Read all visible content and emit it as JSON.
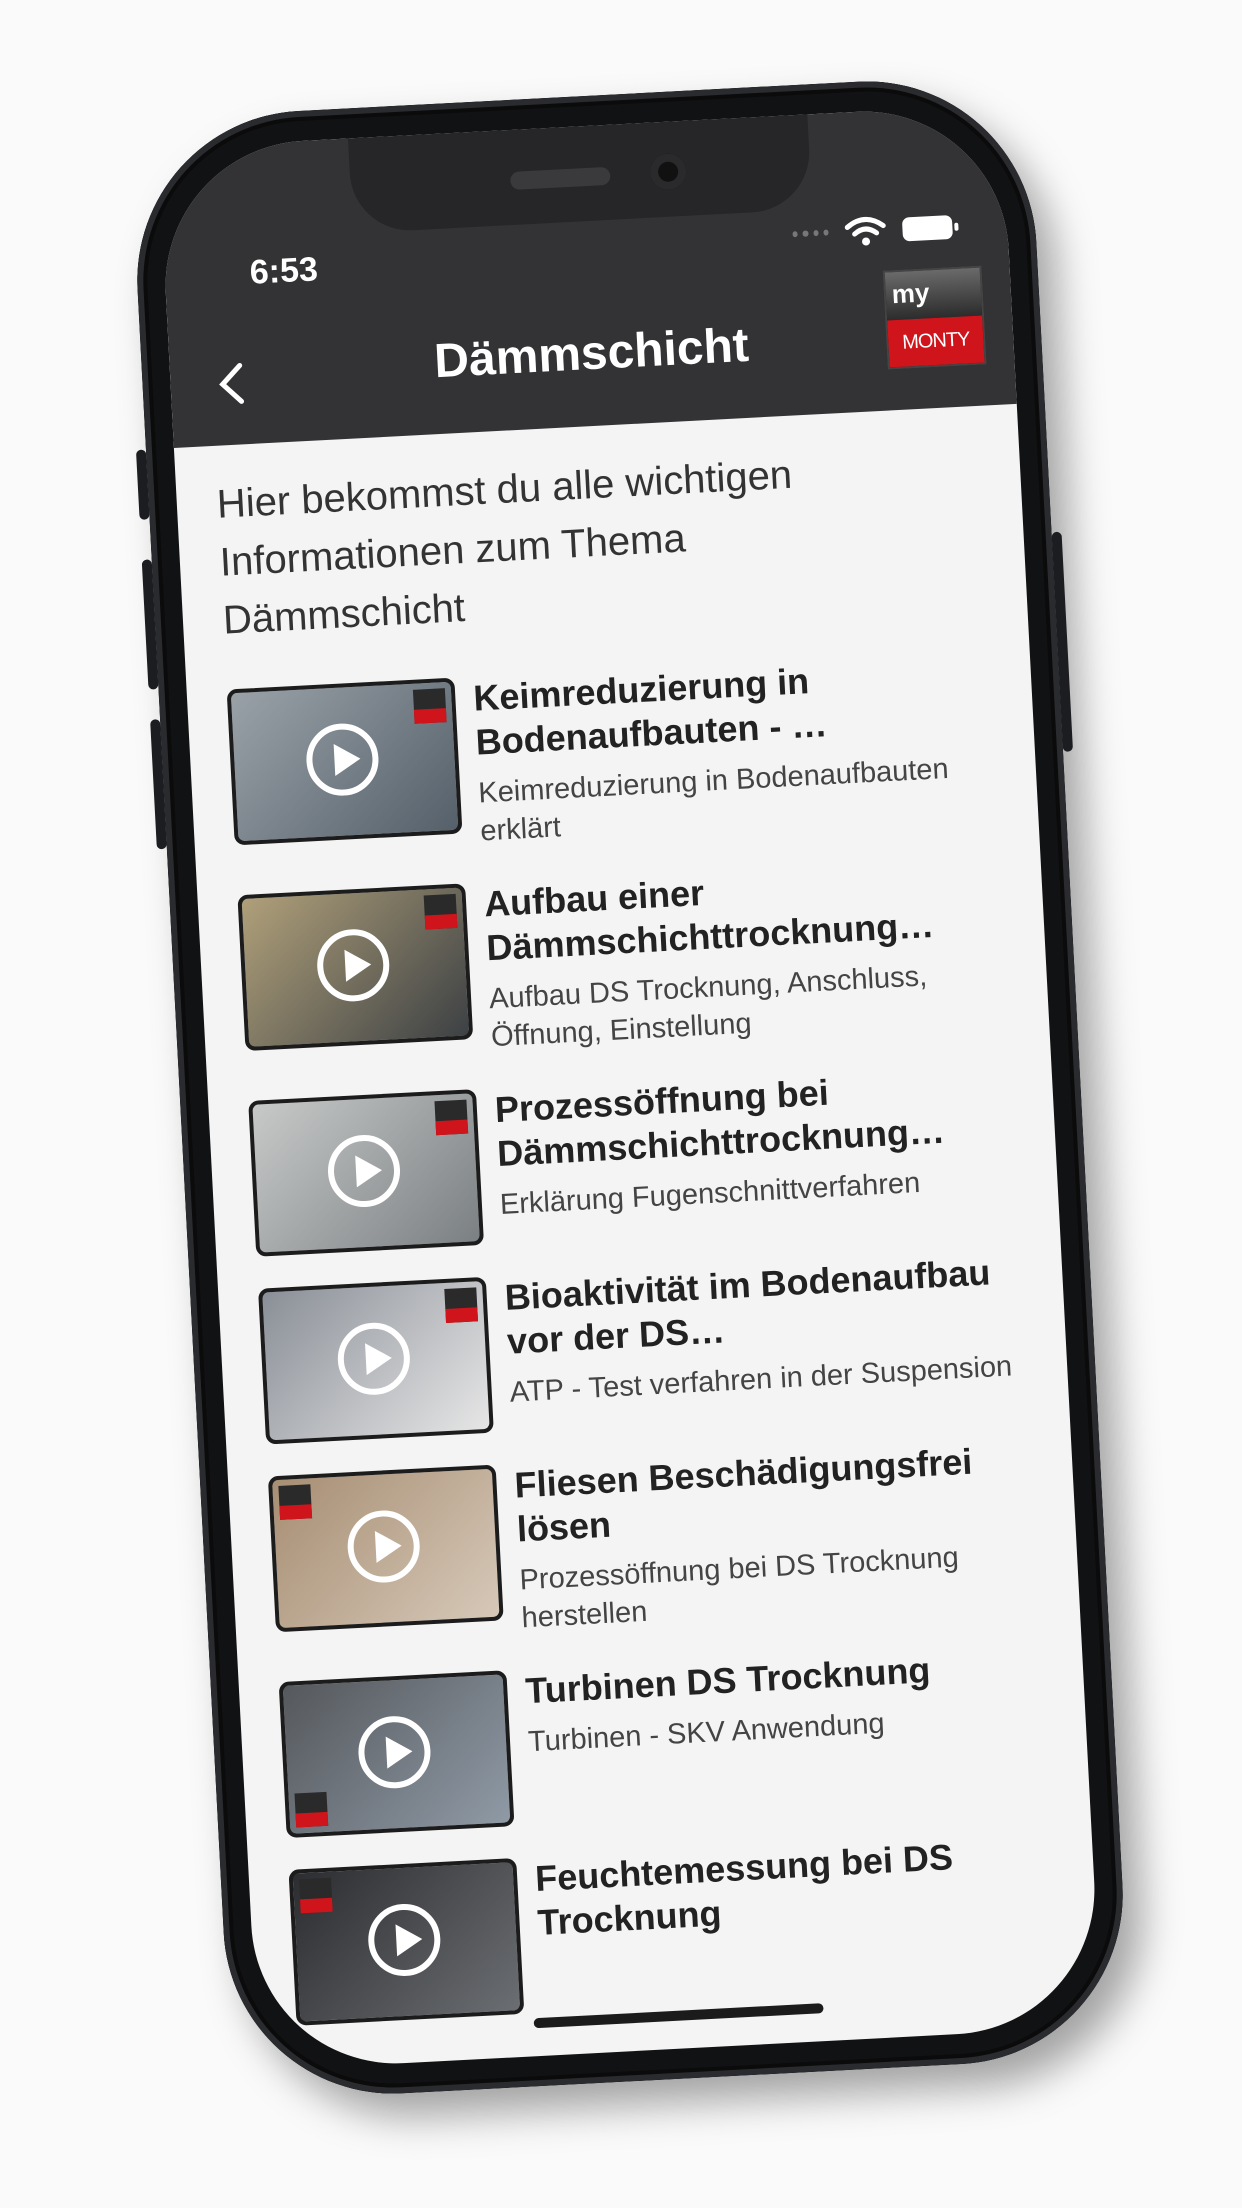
{
  "status": {
    "time": "6:53"
  },
  "header": {
    "title": "Dämmschicht",
    "logo_top": "my",
    "logo_bottom": "MONTY"
  },
  "intro": "Hier bekommst du alle wichtigen Informationen zum Thema Dämmschicht",
  "videos": [
    {
      "title": "Keimreduzierung in Bodenaufbauten - …",
      "subtitle": "Keimreduzierung in Bodenaufbauten erklärt"
    },
    {
      "title": "Aufbau einer Dämmschichttrocknung…",
      "subtitle": "Aufbau DS Trocknung, Anschluss, Öffnung, Einstellung"
    },
    {
      "title": "Prozessöffnung bei Dämmschichttrocknung…",
      "subtitle": "Erklärung Fugenschnittverfahren"
    },
    {
      "title": "Bioaktivität im Bodenaufbau vor der DS…",
      "subtitle": "ATP - Test verfahren in der Suspension"
    },
    {
      "title": "Fliesen Beschädigungsfrei lösen",
      "subtitle": "Prozessöffnung bei DS Trocknung herstellen"
    },
    {
      "title": "Turbinen DS Trocknung",
      "subtitle": "Turbinen - SKV Anwendung"
    },
    {
      "title": "Feuchtemessung bei DS Trocknung",
      "subtitle": ""
    }
  ]
}
